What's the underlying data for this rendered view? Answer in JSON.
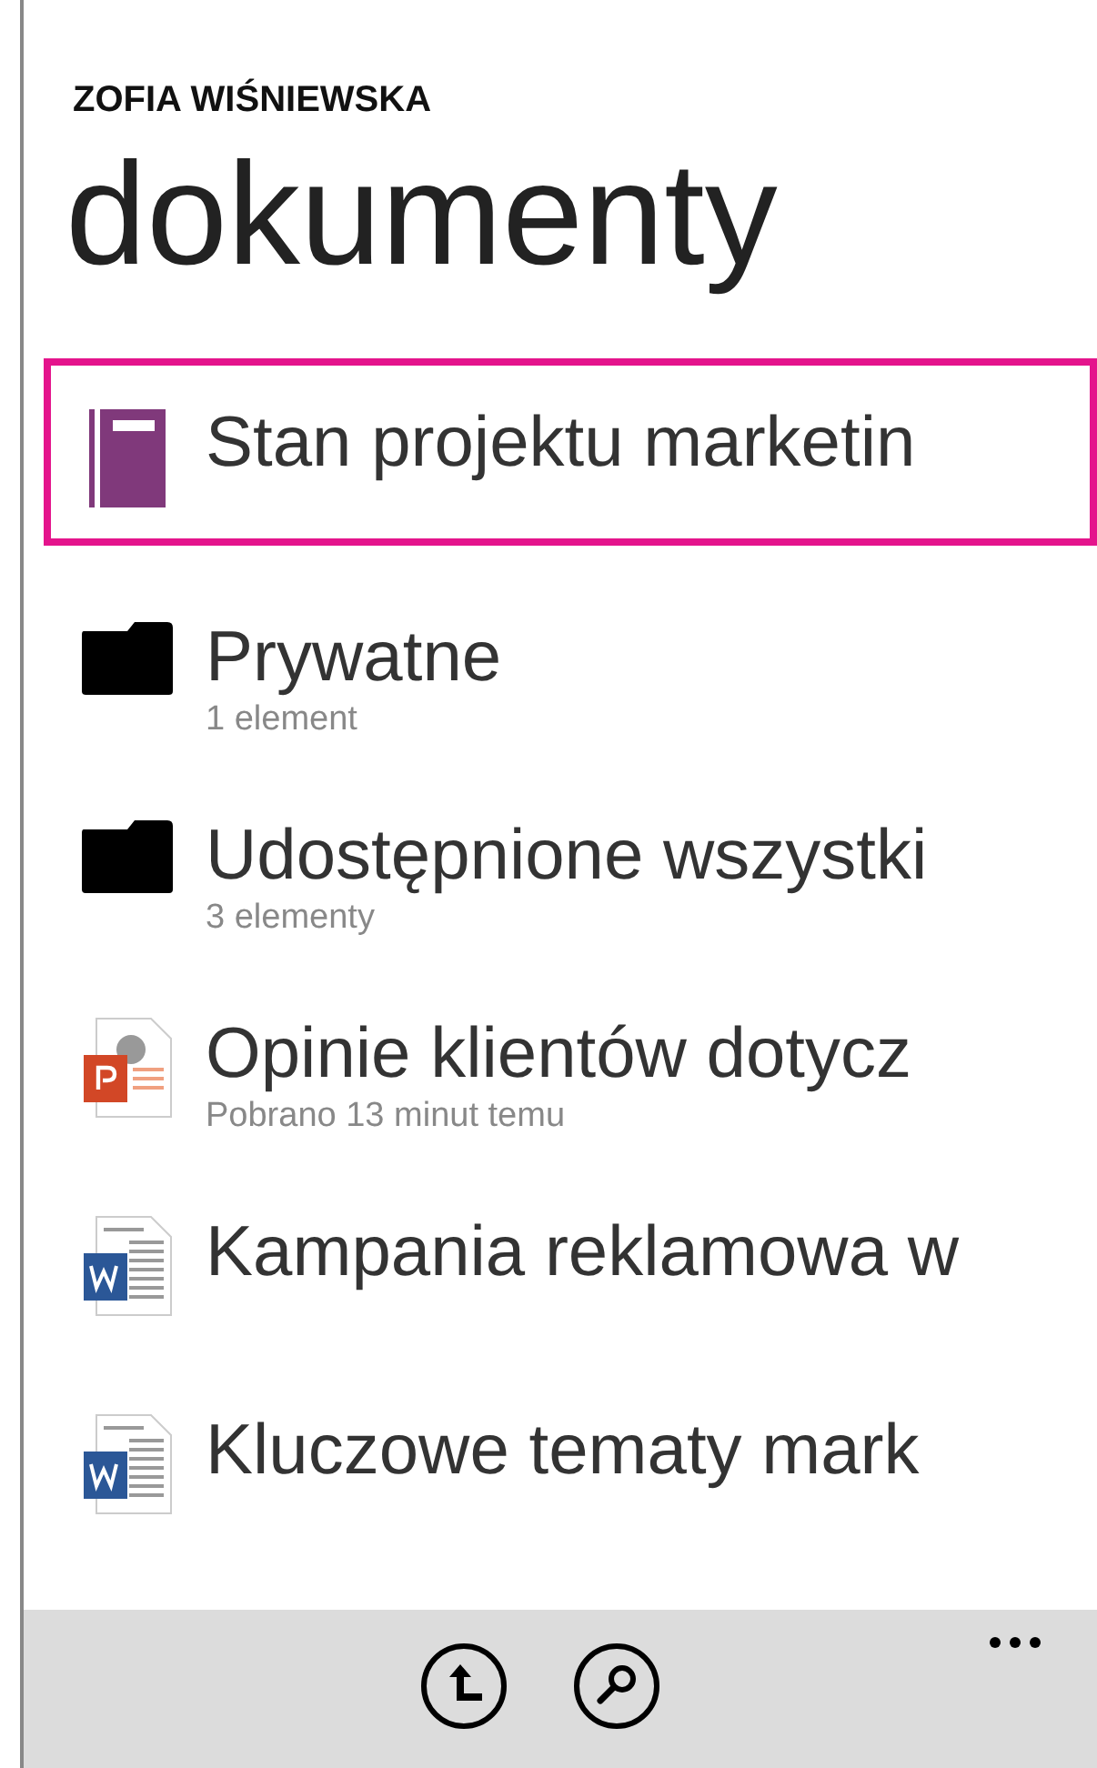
{
  "header": {
    "account": "ZOFIA WIŚNIEWSKA",
    "title": "dokumenty"
  },
  "items": [
    {
      "kind": "notebook",
      "title": "Stan projektu marketin",
      "selected": true
    },
    {
      "kind": "folder",
      "title": "Prywatne",
      "subtitle": "1 element",
      "selected": false
    },
    {
      "kind": "folder",
      "title": "Udostępnione wszystki",
      "subtitle": "3 elementy",
      "selected": false
    },
    {
      "kind": "powerpoint",
      "title": "Opinie klientów dotycz",
      "subtitle": "Pobrano 13 minut temu",
      "selected": false
    },
    {
      "kind": "word",
      "title": "Kampania reklamowa w",
      "selected": false
    },
    {
      "kind": "word",
      "title": "Kluczowe tematy mark",
      "selected": false
    }
  ]
}
